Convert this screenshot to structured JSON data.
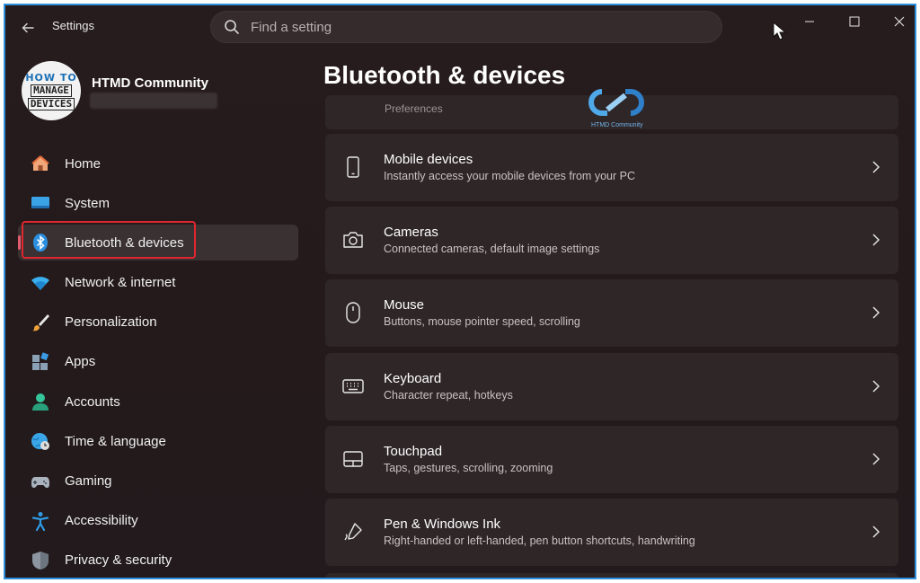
{
  "app": {
    "title": "Settings"
  },
  "search": {
    "placeholder": "Find a setting"
  },
  "window_controls": {
    "minimize": "—",
    "maximize": "☐",
    "close": "✕"
  },
  "profile": {
    "name": "HTMD Community",
    "avatar_lines": [
      "HOW TO",
      "MANAGE",
      "DEVICES"
    ]
  },
  "sidebar": {
    "items": [
      {
        "label": "Home",
        "icon": "home-icon"
      },
      {
        "label": "System",
        "icon": "monitor-icon"
      },
      {
        "label": "Bluetooth & devices",
        "icon": "bluetooth-icon",
        "active": true
      },
      {
        "label": "Network & internet",
        "icon": "wifi-icon"
      },
      {
        "label": "Personalization",
        "icon": "brush-icon"
      },
      {
        "label": "Apps",
        "icon": "apps-icon"
      },
      {
        "label": "Accounts",
        "icon": "person-icon"
      },
      {
        "label": "Time & language",
        "icon": "globe-clock-icon"
      },
      {
        "label": "Gaming",
        "icon": "gamepad-icon"
      },
      {
        "label": "Accessibility",
        "icon": "accessibility-icon"
      },
      {
        "label": "Privacy & security",
        "icon": "shield-icon"
      }
    ]
  },
  "main": {
    "title": "Bluetooth & devices",
    "watermark_text": "HTMD Community",
    "previous_card_fragment": "Preferences",
    "cards": [
      {
        "title": "Mobile devices",
        "subtitle": "Instantly access your mobile devices from your PC",
        "icon": "phone-icon"
      },
      {
        "title": "Cameras",
        "subtitle": "Connected cameras, default image settings",
        "icon": "camera-icon"
      },
      {
        "title": "Mouse",
        "subtitle": "Buttons, mouse pointer speed, scrolling",
        "icon": "mouse-icon"
      },
      {
        "title": "Keyboard",
        "subtitle": "Character repeat, hotkeys",
        "icon": "keyboard-icon"
      },
      {
        "title": "Touchpad",
        "subtitle": "Taps, gestures, scrolling, zooming",
        "icon": "touchpad-icon"
      },
      {
        "title": "Pen & Windows Ink",
        "subtitle": "Right-handed or left-handed, pen button shortcuts, handwriting",
        "icon": "pen-icon"
      }
    ]
  },
  "colors": {
    "accent": "#e05d6f",
    "highlight_box": "#e0262e",
    "frame": "#2f8fdc",
    "background": "#241b1d",
    "card": "#2f2628"
  }
}
